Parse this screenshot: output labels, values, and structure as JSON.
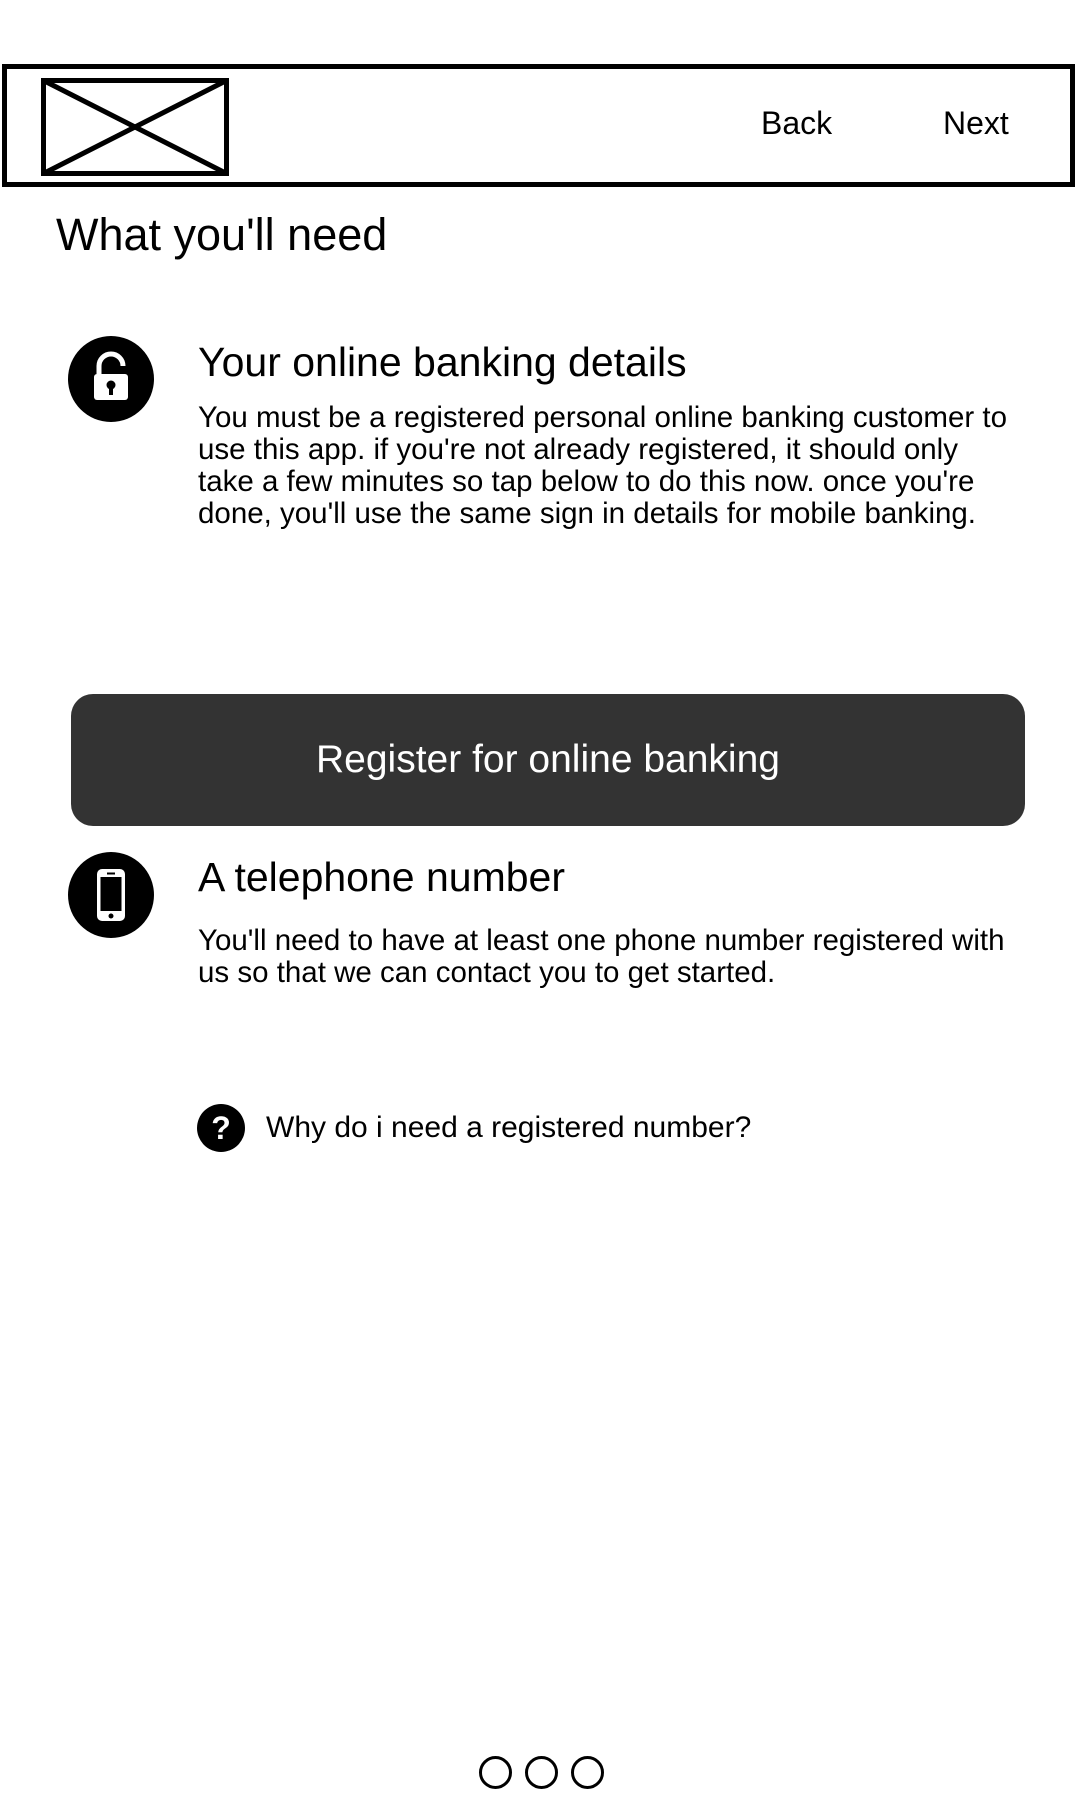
{
  "header": {
    "logo_icon": "image-placeholder-icon",
    "back_label": "Back",
    "next_label": "Next"
  },
  "page": {
    "title": "What you'll need"
  },
  "sections": [
    {
      "icon": "lock-icon",
      "heading": "Your online banking details",
      "body": "You must be a registered personal online banking customer to use this app. if you're not already registered, it should only take a few minutes so tap below to do this now. once you're done, you'll use the same sign in details for mobile banking."
    },
    {
      "icon": "smartphone-icon",
      "heading": "A telephone number",
      "body": "You'll need to have at least one phone number registered with us so that we can contact you to get started."
    }
  ],
  "register_button": {
    "label": "Register for online banking",
    "color": "#333333"
  },
  "help": {
    "icon": "question-icon",
    "glyph": "?",
    "label": "Why do i need a registered number?"
  },
  "pager": {
    "pages": 3
  }
}
